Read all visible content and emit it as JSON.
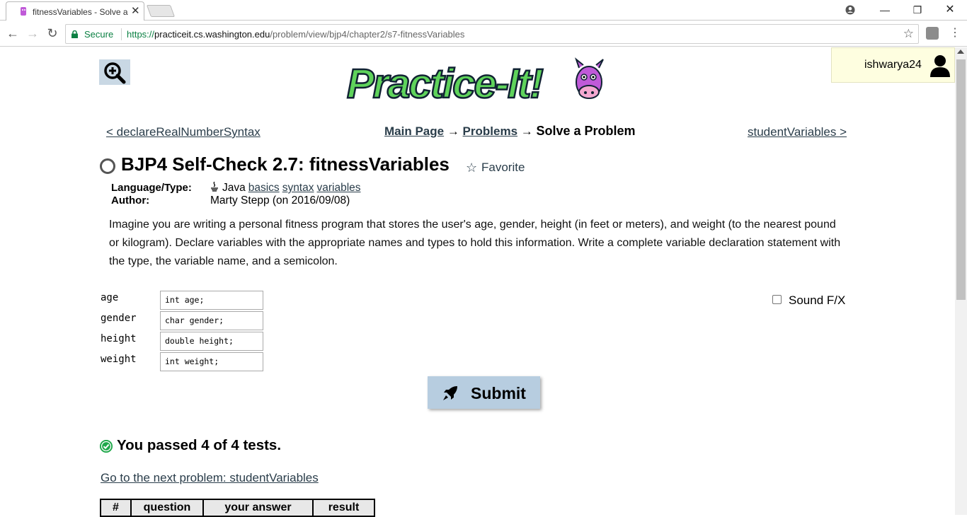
{
  "browser": {
    "tab_title": "fitnessVariables - Solve a",
    "secure_label": "Secure",
    "url_scheme": "https://",
    "url_host": "practiceit.cs.washington.edu",
    "url_path": "/problem/view/bjp4/chapter2/s7-fitnessVariables"
  },
  "user": {
    "name": "ishwarya24"
  },
  "nav": {
    "prev_link": "< declareRealNumberSyntax",
    "next_link": "studentVariables >",
    "crumb_main": "Main Page",
    "crumb_arrow1": " → ",
    "crumb_problems": "Problems",
    "crumb_arrow2": " → ",
    "crumb_current": "Solve a Problem"
  },
  "problem": {
    "title": "BJP4 Self-Check 2.7: fitnessVariables",
    "favorite_label": "Favorite",
    "lang_label": "Language/Type:",
    "lang_value": "Java",
    "tags": [
      "basics",
      "syntax",
      "variables"
    ],
    "author_label": "Author:",
    "author_value": "Marty Stepp (on 2016/09/08)",
    "description": "Imagine you are writing a personal fitness program that stores the user's age, gender, height (in feet or meters), and weight (to the nearest pound or kilogram). Declare variables with the appropriate names and types to hold this information. Write a complete variable declaration statement with the type, the variable name, and a semicolon."
  },
  "fields": [
    {
      "label": "age",
      "value": "int age;"
    },
    {
      "label": "gender",
      "value": "char gender;"
    },
    {
      "label": "height",
      "value": "double height;"
    },
    {
      "label": "weight",
      "value": "int weight;"
    }
  ],
  "sound_label": "Sound F/X",
  "submit_label": "Submit",
  "result": {
    "passed_text": "You passed 4 of 4 tests.",
    "next_problem_link": "Go to the next problem: studentVariables"
  },
  "results_table": {
    "headers": [
      "#",
      "question",
      "your answer",
      "result"
    ]
  },
  "colors": {
    "link": "#2a3d4a",
    "submit_bg": "#b7cde0",
    "userbox_bg": "#fefee0",
    "pass_green": "#1fa84a",
    "logo_green": "#5fd35b",
    "mascot_purple": "#c05ad8"
  }
}
